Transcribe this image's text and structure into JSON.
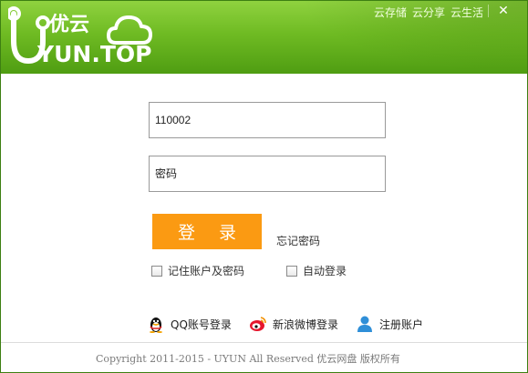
{
  "header": {
    "logo_text": "YUN.TOP",
    "logo_cn": "优云",
    "links": [
      "云存储",
      "云分享",
      "云生活"
    ],
    "close_label": "✕",
    "colors": {
      "green_top": "#8fd23f",
      "green_bottom": "#4f9d12"
    }
  },
  "login": {
    "account_value": "110002",
    "password_placeholder": "密码",
    "login_button": "登 录",
    "forgot_password": "忘记密码",
    "remember_label": "记住账户及密码",
    "autologin_label": "自动登录",
    "accent": "#fb9a12"
  },
  "social": {
    "qq_label": "QQ账号登录",
    "weibo_label": "新浪微博登录",
    "register_label": "注册账户"
  },
  "footer": {
    "copyright": "Copyright 2011-2015 - UYUN All Reserved  优云网盘 版权所有"
  }
}
